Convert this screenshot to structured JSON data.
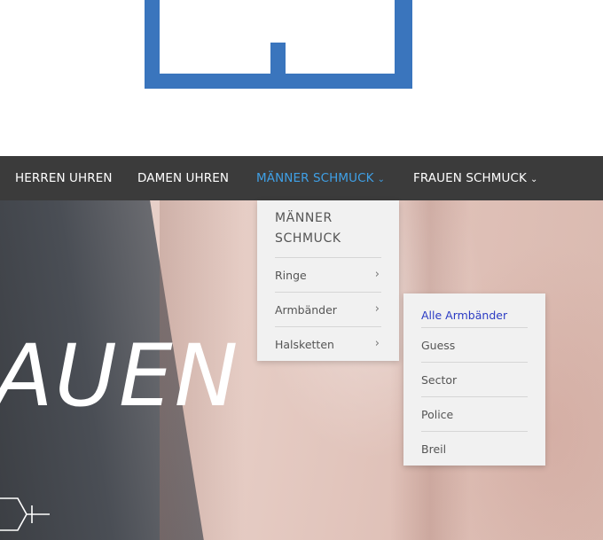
{
  "nav": {
    "items": [
      {
        "label": "HERREN UHREN"
      },
      {
        "label": "DAMEN UHREN"
      },
      {
        "label": "MÄNNER SCHMUCK",
        "chevron": "⌄"
      },
      {
        "label": "FRAUEN SCHMUCK",
        "chevron": "⌄"
      }
    ],
    "active_color": "#3fa0e6",
    "bar_color": "#3b3b3b"
  },
  "dropdown": {
    "title_line1": "MÄNNER",
    "title_line2": "SCHMUCK",
    "items": [
      {
        "label": "Ringe",
        "chevron": "›"
      },
      {
        "label": "Armbänder",
        "chevron": "›"
      },
      {
        "label": "Halsketten",
        "chevron": "›"
      }
    ]
  },
  "submenu": {
    "items": [
      {
        "label": "Alle Armbänder"
      },
      {
        "label": "Guess"
      },
      {
        "label": "Sector"
      },
      {
        "label": "Police"
      },
      {
        "label": "Breil"
      }
    ],
    "selected_color": "#2b3bc4"
  },
  "hero": {
    "title": "AUEN"
  },
  "logo": {
    "color": "#3a75bd"
  }
}
